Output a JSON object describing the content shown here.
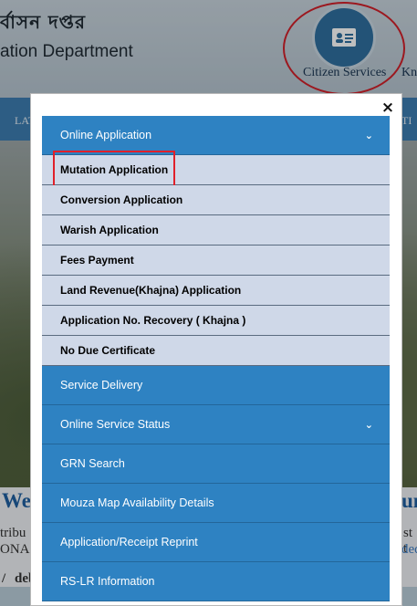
{
  "background": {
    "dept_title_line1": "র্বাসন দপ্তর",
    "dept_title_line2": "ation Department",
    "citizen_services_label": "Citizen Services",
    "kn_fragment": "Kn",
    "nav_left_fragment": "LAT",
    "nav_right_fragment": "TI",
    "welcome_left": "We",
    "welcome_right": "un",
    "frag_tribu": "tribu",
    "frag_ona": "ONA",
    "frag_deb": "debt",
    "frag_st": "st t",
    "frag_ded": "ded",
    "frag_slash": "/"
  },
  "modal": {
    "close_label": "×",
    "online_application": {
      "label": "Online Application",
      "chevron": "⌄",
      "items": [
        "Mutation Application",
        "Conversion Application",
        "Warish Application",
        "Fees Payment",
        "Land Revenue(Khajna) Application",
        "Application No. Recovery ( Khajna )",
        "No Due Certificate"
      ]
    },
    "sections": [
      {
        "label": "Service Delivery",
        "chevron": ""
      },
      {
        "label": "Online Service Status",
        "chevron": "⌄"
      },
      {
        "label": "GRN Search",
        "chevron": ""
      },
      {
        "label": "Mouza Map Availability Details",
        "chevron": ""
      },
      {
        "label": "Application/Receipt Reprint",
        "chevron": ""
      },
      {
        "label": "RS-LR Information",
        "chevron": ""
      }
    ]
  },
  "colors": {
    "menu_header": "#2e82c2",
    "submenu_bg": "#cfd8e8",
    "highlight_red": "#e0202a"
  }
}
